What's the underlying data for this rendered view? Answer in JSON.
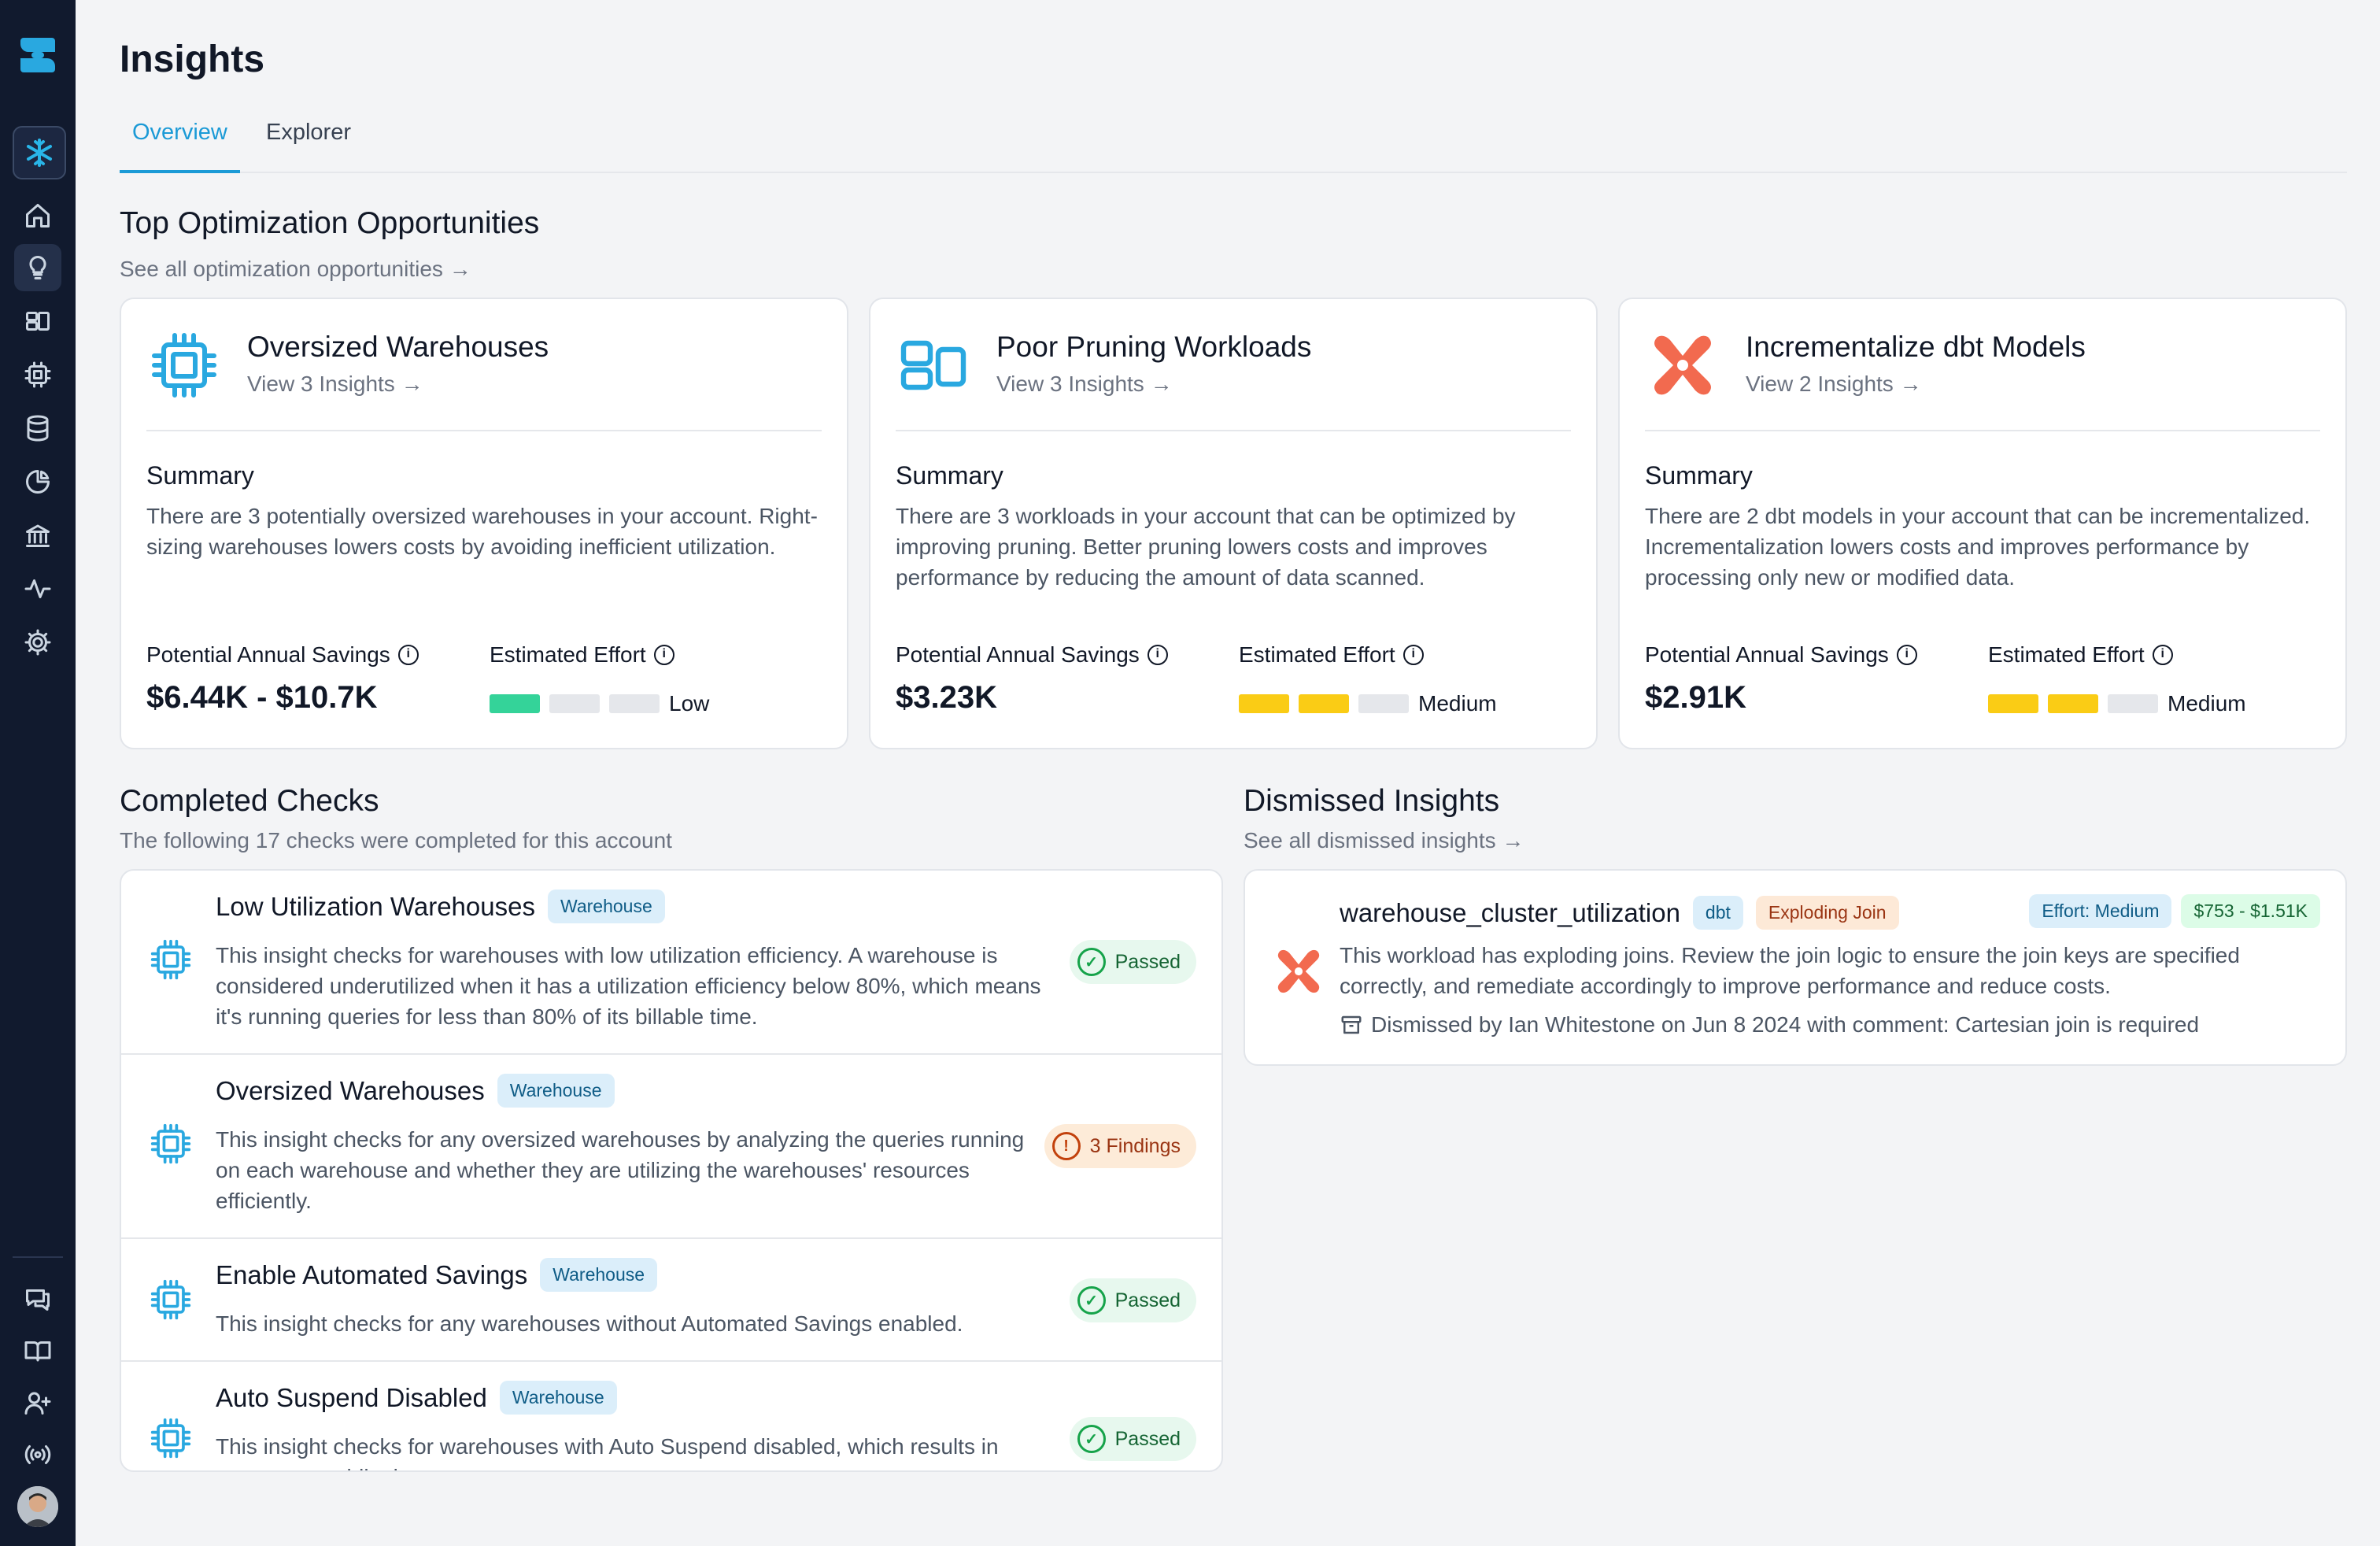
{
  "page": {
    "title": "Insights"
  },
  "tabs": [
    {
      "label": "Overview",
      "active": true
    },
    {
      "label": "Explorer",
      "active": false
    }
  ],
  "sidebar": {
    "items": [
      "snowflake-icon",
      "home-icon",
      "lightbulb-icon",
      "layout-icon",
      "chip-icon",
      "database-icon",
      "pie-chart-icon",
      "bank-icon",
      "activity-icon",
      "gear-icon"
    ],
    "bottom_items": [
      "chat-icon",
      "book-icon",
      "user-plus-icon",
      "broadcast-icon"
    ]
  },
  "top_opportunities": {
    "title": "Top Optimization Opportunities",
    "link": "See all optimization opportunities →",
    "cards": [
      {
        "icon": "chip-icon",
        "title": "Oversized Warehouses",
        "link": "View 3 Insights →",
        "summary_label": "Summary",
        "summary": "There are 3 potentially oversized warehouses in your account. Right-sizing warehouses lowers costs by avoiding inefficient utilization.",
        "savings_label": "Potential Annual Savings",
        "savings": "$6.44K - $10.7K",
        "effort_label": "Estimated Effort",
        "effort": "Low",
        "effort_level": 1,
        "effort_color": "#34d399"
      },
      {
        "icon": "layout-icon",
        "title": "Poor Pruning Workloads",
        "link": "View 3 Insights →",
        "summary_label": "Summary",
        "summary": "There are 3 workloads in your account that can be optimized by improving pruning. Better pruning lowers costs and improves performance by reducing the amount of data scanned.",
        "savings_label": "Potential Annual Savings",
        "savings": "$3.23K",
        "effort_label": "Estimated Effort",
        "effort": "Medium",
        "effort_level": 2,
        "effort_color": "#facc15"
      },
      {
        "icon": "dbt-icon",
        "title": "Incrementalize dbt Models",
        "link": "View 2 Insights →",
        "summary_label": "Summary",
        "summary": "There are 2 dbt models in your account that can be incrementalized. Incrementalization lowers costs and improves performance by processing only new or modified data.",
        "savings_label": "Potential Annual Savings",
        "savings": "$2.91K",
        "effort_label": "Estimated Effort",
        "effort": "Medium",
        "effort_level": 2,
        "effort_color": "#facc15"
      }
    ]
  },
  "completed": {
    "title": "Completed Checks",
    "subtitle": "The following 17 checks were completed for this account",
    "rows": [
      {
        "title": "Low Utilization Warehouses",
        "tag": "Warehouse",
        "text": "This insight checks for warehouses with low utilization efficiency. A warehouse is considered underutilized when it has a utilization efficiency below 80%, which means it's running queries for less than 80% of its billable time.",
        "status": "Passed",
        "status_icon": "✓"
      },
      {
        "title": "Oversized Warehouses",
        "tag": "Warehouse",
        "text": "This insight checks for any oversized warehouses by analyzing the queries running on each warehouse and whether they are utilizing the warehouses' resources efficiently.",
        "status": "3 Findings",
        "status_icon": "!"
      },
      {
        "title": "Enable Automated Savings",
        "tag": "Warehouse",
        "text": "This insight checks for any warehouses without Automated Savings enabled.",
        "status": "Passed",
        "status_icon": "✓"
      },
      {
        "title": "Auto Suspend Disabled",
        "tag": "Warehouse",
        "text": "This insight checks for warehouses with Auto Suspend disabled, which results in unnecessary idle time costs.",
        "status": "Passed",
        "status_icon": "✓"
      }
    ]
  },
  "dismissed": {
    "title": "Dismissed Insights",
    "link": "See all dismissed insights →",
    "item": {
      "title": "warehouse_cluster_utilization",
      "tag_dbt": "dbt",
      "tag_type": "Exploding Join",
      "effort": "Effort: Medium",
      "savings": "$753 - $1.51K",
      "text": "This workload has exploding joins. Review the join logic to ensure the join keys are specified correctly, and remediate accordingly to improve performance and reduce costs.",
      "meta": "Dismissed by Ian Whitestone on Jun 8 2024 with comment: Cartesian join is required"
    }
  }
}
